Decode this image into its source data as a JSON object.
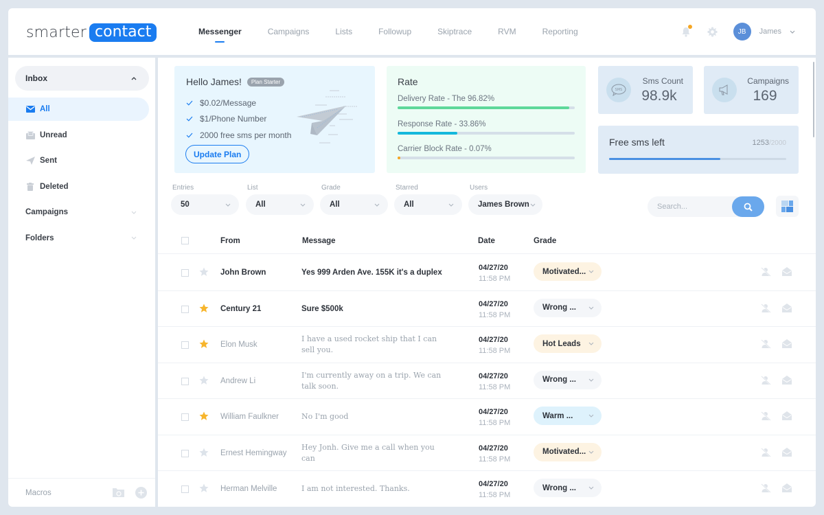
{
  "header": {
    "logo_part1": "smarter",
    "logo_part2": "contact",
    "nav": [
      {
        "label": "Messenger",
        "active": true
      },
      {
        "label": "Campaigns",
        "active": false
      },
      {
        "label": "Lists",
        "active": false
      },
      {
        "label": "Followup",
        "active": false
      },
      {
        "label": "Skiptrace",
        "active": false
      },
      {
        "label": "RVM",
        "active": false
      },
      {
        "label": "Reporting",
        "active": false
      }
    ],
    "avatar_initials": "JB",
    "user_name": "James",
    "notification_dot_color": "#f5a623"
  },
  "sidebar": {
    "inbox_label": "Inbox",
    "items": [
      {
        "label": "All",
        "icon": "envelope-icon",
        "active": true
      },
      {
        "label": "Unread",
        "icon": "unread-mail-icon",
        "active": false
      },
      {
        "label": "Sent",
        "icon": "paper-plane-icon",
        "active": false
      },
      {
        "label": "Deleted",
        "icon": "trash-icon",
        "active": false
      }
    ],
    "groups": [
      {
        "label": "Campaigns"
      },
      {
        "label": "Folders"
      }
    ],
    "footer_label": "Macros"
  },
  "hello_card": {
    "title": "Hello James!",
    "plan_badge": "Plan Starter",
    "features": [
      "$0.02/Message",
      "$1/Phone Number",
      "2000 free sms per month"
    ],
    "button_label": "Update Plan"
  },
  "rate_card": {
    "title": "Rate",
    "rates": [
      {
        "label": "Delivery Rate - The 96.82%",
        "percent": 96.82,
        "color": "#5ed89a"
      },
      {
        "label": "Response Rate - 33.86%",
        "percent": 33.86,
        "color": "#14b8dc"
      },
      {
        "label": "Carrier Block Rate - 0.07%",
        "percent": 0.07,
        "color": "#f5a623"
      }
    ]
  },
  "stats": [
    {
      "label": "Sms Count",
      "value": "98.9k",
      "icon": "sms-bubble-icon"
    },
    {
      "label": "Campaigns",
      "value": "169",
      "icon": "megaphone-icon"
    }
  ],
  "free_sms": {
    "label": "Free sms left",
    "used": "1253",
    "total": "/2000",
    "fraction": 0.6265
  },
  "filters": [
    {
      "label": "Entries",
      "value": "50"
    },
    {
      "label": "List",
      "value": "All"
    },
    {
      "label": "Grade",
      "value": "All"
    },
    {
      "label": "Starred",
      "value": "All"
    },
    {
      "label": "Users",
      "value": "James Brown"
    }
  ],
  "search": {
    "placeholder": "Search...",
    "value": ""
  },
  "table": {
    "headers": {
      "from": "From",
      "message": "Message",
      "date": "Date",
      "grade": "Grade"
    },
    "rows": [
      {
        "from": "John Brown",
        "message": "Yes 999 Arden Ave. 155K it's a duplex",
        "date": "04/27/20",
        "time": "11:58 PM",
        "grade": "Motivated...",
        "grade_color": "#fdf3e2",
        "starred": false,
        "unread": true
      },
      {
        "from": "Century 21",
        "message": "Sure $500k",
        "date": "04/27/20",
        "time": "11:58 PM",
        "grade": "Wrong ...",
        "grade_color": "#f4f6f9",
        "starred": true,
        "unread": true
      },
      {
        "from": "Elon Musk",
        "message": "I have a used rocket ship that I can sell you.",
        "date": "04/27/20",
        "time": "11:58 PM",
        "grade": "Hot Leads",
        "grade_color": "#fdf3e2",
        "starred": true,
        "unread": false
      },
      {
        "from": "Andrew Li",
        "message": "I'm currently away on a trip. We can talk soon.",
        "date": "04/27/20",
        "time": "11:58 PM",
        "grade": "Wrong ...",
        "grade_color": "#f4f6f9",
        "starred": false,
        "unread": false
      },
      {
        "from": "William Faulkner",
        "message": "No I'm good",
        "date": "04/27/20",
        "time": "11:58 PM",
        "grade": "Warm ...",
        "grade_color": "#def2fc",
        "starred": true,
        "unread": false
      },
      {
        "from": "Ernest Hemingway",
        "message": "Hey Jonh. Give me a call when you can",
        "date": "04/27/20",
        "time": "11:58 PM",
        "grade": "Motivated...",
        "grade_color": "#fdf3e2",
        "starred": false,
        "unread": false
      },
      {
        "from": "Herman Melville",
        "message": "I am not interested. Thanks.",
        "date": "04/27/20",
        "time": "11:58 PM",
        "grade": "Wrong ...",
        "grade_color": "#f4f6f9",
        "starred": false,
        "unread": false
      }
    ]
  },
  "colors": {
    "accent": "#1a7cf0",
    "star_active": "#f7b52c",
    "star_inactive": "#dde3ea"
  }
}
